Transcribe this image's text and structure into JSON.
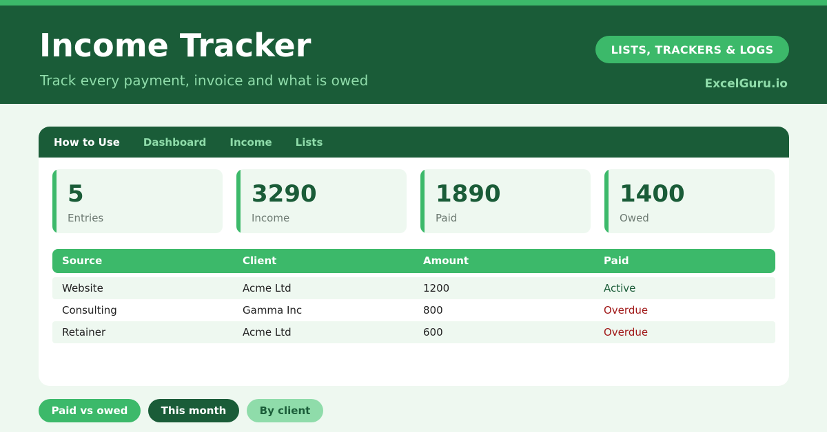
{
  "header": {
    "title": "Income Tracker",
    "subtitle": "Track every payment, invoice and what is owed",
    "category_pill": "LISTS, TRACKERS & LOGS",
    "brand": "ExcelGuru.io"
  },
  "tabs": [
    {
      "label": "How to Use",
      "active": true
    },
    {
      "label": "Dashboard",
      "active": false
    },
    {
      "label": "Income",
      "active": false
    },
    {
      "label": "Lists",
      "active": false
    }
  ],
  "stats": [
    {
      "value": "5",
      "label": "Entries"
    },
    {
      "value": "3290",
      "label": "Income"
    },
    {
      "value": "1890",
      "label": "Paid"
    },
    {
      "value": "1400",
      "label": "Owed"
    }
  ],
  "table": {
    "columns": [
      "Source",
      "Client",
      "Amount",
      "Paid"
    ],
    "rows": [
      {
        "source": "Website",
        "client": "Acme Ltd",
        "amount": "1200",
        "paid": "Active"
      },
      {
        "source": "Consulting",
        "client": "Gamma Inc",
        "amount": "800",
        "paid": "Overdue"
      },
      {
        "source": "Retainer",
        "client": "Acme Ltd",
        "amount": "600",
        "paid": "Overdue"
      }
    ]
  },
  "filters": [
    {
      "label": "Paid vs owed"
    },
    {
      "label": "This month"
    },
    {
      "label": "By client"
    }
  ],
  "colors": {
    "dark_green": "#1a5c38",
    "accent_green": "#3cb96a",
    "light_green_text": "#8fdcaa",
    "pale_bg": "#eef8f0",
    "status_active": "#1a5c38",
    "status_overdue": "#a01818"
  }
}
